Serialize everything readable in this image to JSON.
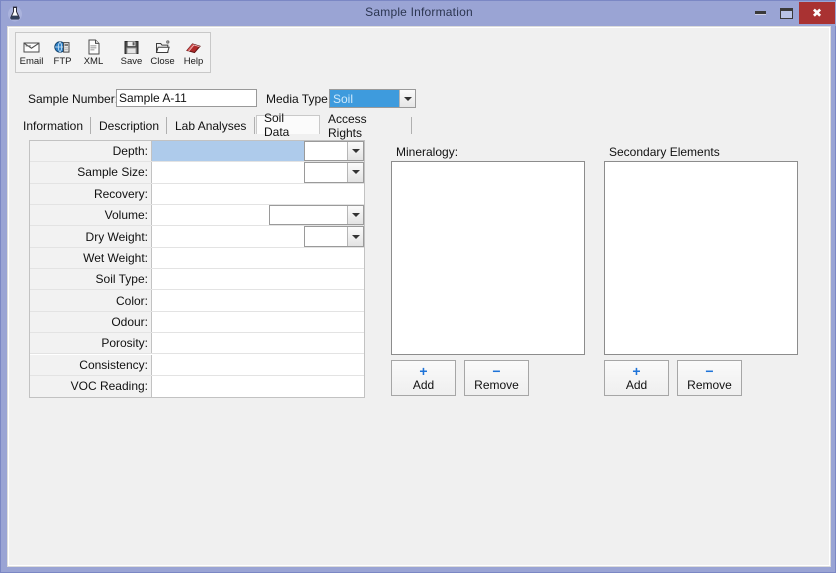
{
  "window": {
    "title": "Sample Information",
    "icon": "flask-icon",
    "controls": {
      "minimize": "minimize-icon",
      "maximize": "maximize-icon",
      "close": "close-icon",
      "close_glyph": "✖"
    },
    "border_color": "#9aa4d4",
    "titlebar_text_color": "#2b3550",
    "close_button_color": "#a93232"
  },
  "toolbar": {
    "buttons": [
      {
        "label": "Email",
        "icon": "envelope-icon"
      },
      {
        "label": "FTP",
        "icon": "ftp-globe-icon"
      },
      {
        "label": "XML",
        "icon": "xml-document-icon"
      },
      {
        "label": "Save",
        "icon": "floppy-disk-icon"
      },
      {
        "label": "Close",
        "icon": "folder-close-icon"
      },
      {
        "label": "Help",
        "icon": "help-book-icon"
      }
    ]
  },
  "header": {
    "sample_number_label": "Sample Number:",
    "sample_number_value": "Sample A-11",
    "sample_number_placeholder": "",
    "media_type_label": "Media Type:",
    "media_type_value": "Soil",
    "media_type_selected": true,
    "selection_color": "#3e9bdd"
  },
  "tabs": {
    "active": "Soil Data",
    "items": [
      {
        "label": "Information"
      },
      {
        "label": "Description"
      },
      {
        "label": "Lab Analyses"
      },
      {
        "label": "Soil Data"
      },
      {
        "label": "Access Rights"
      }
    ]
  },
  "soil_form": {
    "rows": [
      {
        "label": "Depth:",
        "value": "",
        "unit": "",
        "has_unit": true,
        "unit_wide": false,
        "focused": true
      },
      {
        "label": "Sample Size:",
        "value": "",
        "unit": "",
        "has_unit": true,
        "unit_wide": false,
        "focused": false
      },
      {
        "label": "Recovery:",
        "value": "",
        "unit": "",
        "has_unit": false,
        "unit_wide": false,
        "focused": false
      },
      {
        "label": "Volume:",
        "value": "",
        "unit": "",
        "has_unit": true,
        "unit_wide": true,
        "focused": false
      },
      {
        "label": "Dry Weight:",
        "value": "",
        "unit": "",
        "has_unit": true,
        "unit_wide": false,
        "focused": false
      },
      {
        "label": "Wet Weight:",
        "value": "",
        "unit": "",
        "has_unit": false,
        "unit_wide": false,
        "focused": false
      },
      {
        "label": "Soil Type:",
        "value": "",
        "unit": "",
        "has_unit": false,
        "unit_wide": false,
        "focused": false
      },
      {
        "label": "Color:",
        "value": "",
        "unit": "",
        "has_unit": false,
        "unit_wide": false,
        "focused": false
      },
      {
        "label": "Odour:",
        "value": "",
        "unit": "",
        "has_unit": false,
        "unit_wide": false,
        "focused": false
      },
      {
        "label": "Porosity:",
        "value": "",
        "unit": "",
        "has_unit": false,
        "unit_wide": false,
        "focused": false
      },
      {
        "label": "Consistency:",
        "value": "",
        "unit": "",
        "has_unit": false,
        "unit_wide": false,
        "focused": false
      },
      {
        "label": "VOC Reading:",
        "value": "",
        "unit": "",
        "has_unit": false,
        "unit_wide": false,
        "focused": false
      }
    ],
    "focused_row_color": "#aecbeb"
  },
  "mineralogy": {
    "title": "Mineralogy:",
    "items": [],
    "add_label": "Add",
    "add_symbol": "+",
    "remove_label": "Remove",
    "remove_symbol": "−"
  },
  "secondary_elements": {
    "title": "Secondary Elements",
    "items": [],
    "add_label": "Add",
    "add_symbol": "+",
    "remove_label": "Remove",
    "remove_symbol": "−"
  },
  "colors": {
    "accent_blue": "#1e73d8",
    "client_background": "#f0f0f0",
    "field_background": "#ffffff"
  }
}
